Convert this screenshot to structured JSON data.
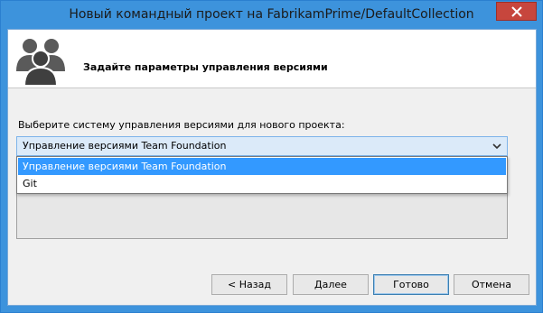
{
  "window": {
    "title": "Новый командный проект на FabrikamPrime/DefaultCollection",
    "close_glyph": "✕"
  },
  "header": {
    "title": "Задайте параметры управления версиями",
    "icon": "team-users-icon"
  },
  "main": {
    "prompt": "Выберите систему управления версиями для нового проекта:",
    "combo": {
      "selected": "Управление версиями Team Foundation",
      "options": [
        "Управление версиями Team Foundation",
        "Git"
      ]
    }
  },
  "buttons": {
    "back": "< Назад",
    "next": "Далее",
    "finish": "Готово",
    "cancel": "Отмена"
  },
  "colors": {
    "titlebar": "#3d93dc",
    "close": "#c7463d",
    "highlight": "#3399ff"
  }
}
